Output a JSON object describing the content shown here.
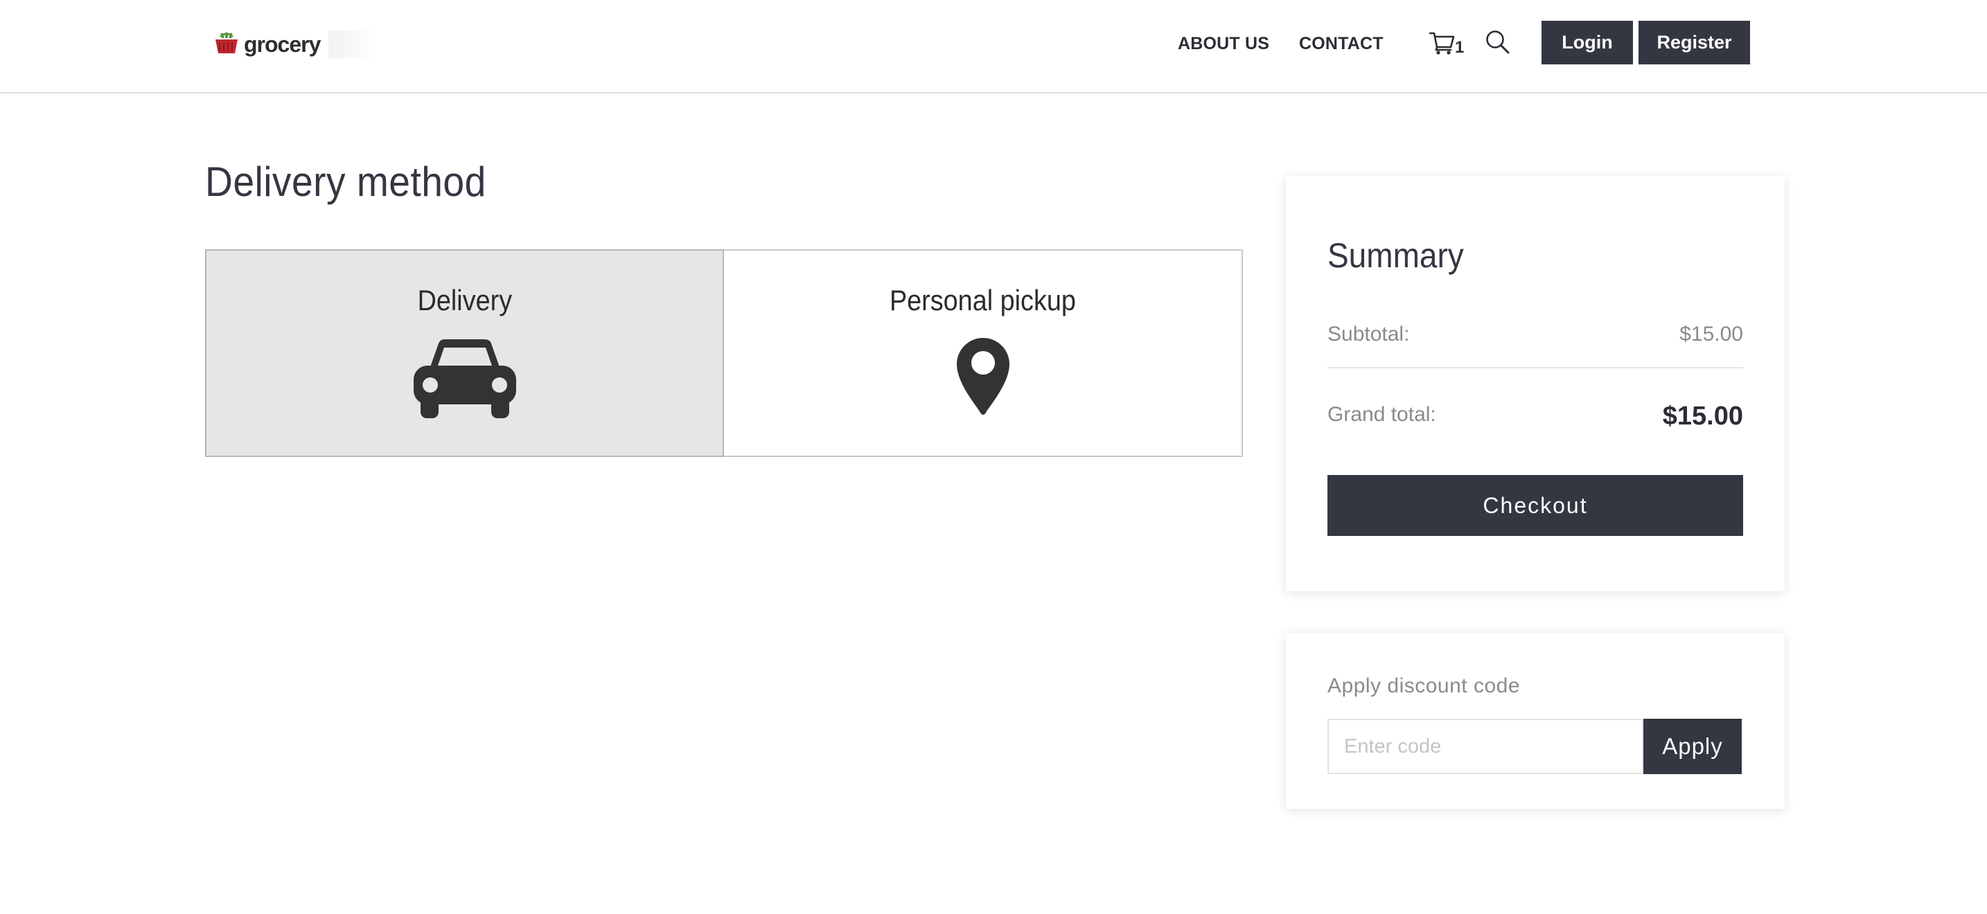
{
  "header": {
    "logo_text": "grocery",
    "nav": {
      "about": "ABOUT US",
      "contact": "CONTACT"
    },
    "cart_count": "1",
    "login_label": "Login",
    "register_label": "Register",
    "icons": {
      "logo": "basket-icon",
      "cart": "cart-icon",
      "search": "search-icon"
    }
  },
  "delivery": {
    "title": "Delivery method",
    "options": [
      {
        "label": "Delivery",
        "icon": "car-icon",
        "selected": true
      },
      {
        "label": "Personal pickup",
        "icon": "map-marker-icon",
        "selected": false
      }
    ]
  },
  "summary": {
    "title": "Summary",
    "subtotal_label": "Subtotal:",
    "subtotal_value": "$15.00",
    "grand_total_label": "Grand total:",
    "grand_total_value": "$15.00",
    "checkout_label": "Checkout"
  },
  "discount": {
    "title": "Apply discount code",
    "placeholder": "Enter code",
    "value": "",
    "apply_label": "Apply"
  },
  "colors": {
    "primary": "#343741",
    "selected_background": "#e6e6e6",
    "muted_text": "#8a8a8a"
  }
}
